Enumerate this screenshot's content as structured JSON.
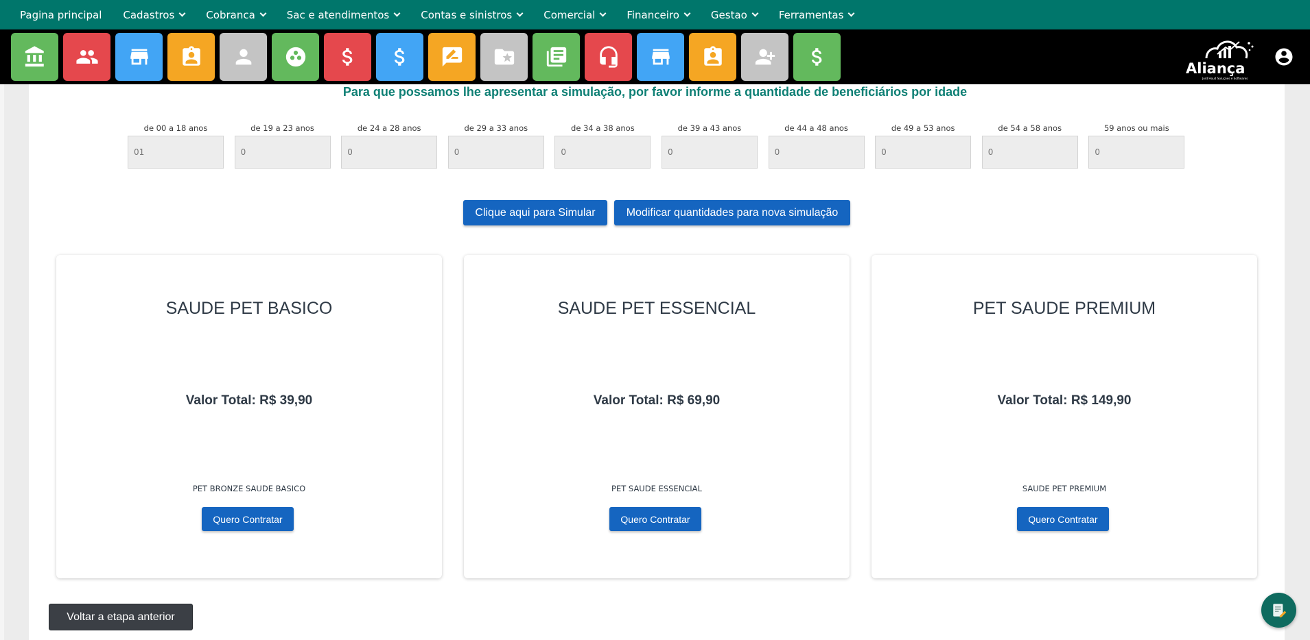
{
  "nav": {
    "items": [
      {
        "label": "Pagina principal",
        "has_dropdown": false
      },
      {
        "label": "Cadastros",
        "has_dropdown": true
      },
      {
        "label": "Cobranca",
        "has_dropdown": true
      },
      {
        "label": "Sac e atendimentos",
        "has_dropdown": true
      },
      {
        "label": "Contas e sinistros",
        "has_dropdown": true
      },
      {
        "label": "Comercial",
        "has_dropdown": true
      },
      {
        "label": "Financeiro",
        "has_dropdown": true
      },
      {
        "label": "Gestao",
        "has_dropdown": true
      },
      {
        "label": "Ferramentas",
        "has_dropdown": true
      }
    ]
  },
  "toolbar": {
    "tiles": [
      {
        "icon": "bank-icon",
        "color": "#63b95d"
      },
      {
        "icon": "people-icon",
        "color": "#e5484d"
      },
      {
        "icon": "store-icon",
        "color": "#42a5f5"
      },
      {
        "icon": "id-badge-icon",
        "color": "#f5a623"
      },
      {
        "icon": "person-icon",
        "color": "#c4c4c4"
      },
      {
        "icon": "bubble-chart-icon",
        "color": "#63b95d"
      },
      {
        "icon": "dollar-icon",
        "color": "#e5484d"
      },
      {
        "icon": "dollar-icon",
        "color": "#42a5f5"
      },
      {
        "icon": "rate-review-icon",
        "color": "#f5a623"
      },
      {
        "icon": "folder-star-icon",
        "color": "#c4c4c4"
      },
      {
        "icon": "newspaper-icon",
        "color": "#63b95d"
      },
      {
        "icon": "headset-icon",
        "color": "#e5484d"
      },
      {
        "icon": "store-icon",
        "color": "#42a5f5"
      },
      {
        "icon": "id-badge-icon",
        "color": "#f5a623"
      },
      {
        "icon": "add-person-icon",
        "color": "#c4c4c4"
      },
      {
        "icon": "dollar-icon",
        "color": "#63b95d"
      }
    ],
    "logo_text": "Aliança",
    "logo_tagline": "Jord Houd Soluções e Softwares"
  },
  "simulation": {
    "headline": "Para que possamos lhe apresentar a simulação, por favor informe a quantidade de beneficiários por idade",
    "age_groups": [
      {
        "label": "de 00 a 18 anos",
        "value": "01"
      },
      {
        "label": "de 19 a 23 anos",
        "value": "0"
      },
      {
        "label": "de 24 a 28 anos",
        "value": "0"
      },
      {
        "label": "de 29 a 33 anos",
        "value": "0"
      },
      {
        "label": "de 34 a 38 anos",
        "value": "0"
      },
      {
        "label": "de 39 a 43 anos",
        "value": "0"
      },
      {
        "label": "de 44 a 48 anos",
        "value": "0"
      },
      {
        "label": "de 49 a 53 anos",
        "value": "0"
      },
      {
        "label": "de 54 a 58 anos",
        "value": "0"
      },
      {
        "label": "59 anos ou mais",
        "value": "0"
      }
    ],
    "simulate_label": "Clique aqui para Simular",
    "modify_label": "Modificar quantidades para nova simulação"
  },
  "plans": [
    {
      "title": "SAUDE PET BASICO",
      "price": "Valor Total: R$ 39,90",
      "product": "PET BRONZE SAUDE BASICO",
      "button": "Quero Contratar"
    },
    {
      "title": "SAUDE PET ESSENCIAL",
      "price": "Valor Total: R$ 69,90",
      "product": "PET SAUDE ESSENCIAL",
      "button": "Quero Contratar"
    },
    {
      "title": "PET SAUDE PREMIUM",
      "price": "Valor Total: R$ 149,90",
      "product": "SAUDE PET PREMIUM",
      "button": "Quero Contratar"
    }
  ],
  "footer": {
    "back_label": "Voltar a etapa anterior",
    "fab_icon": "notes-edit-icon"
  },
  "colors": {
    "nav_bg": "#00766b",
    "primary_button": "#1565c0",
    "headline": "#0d7f74",
    "back_button": "#3b3f45"
  }
}
